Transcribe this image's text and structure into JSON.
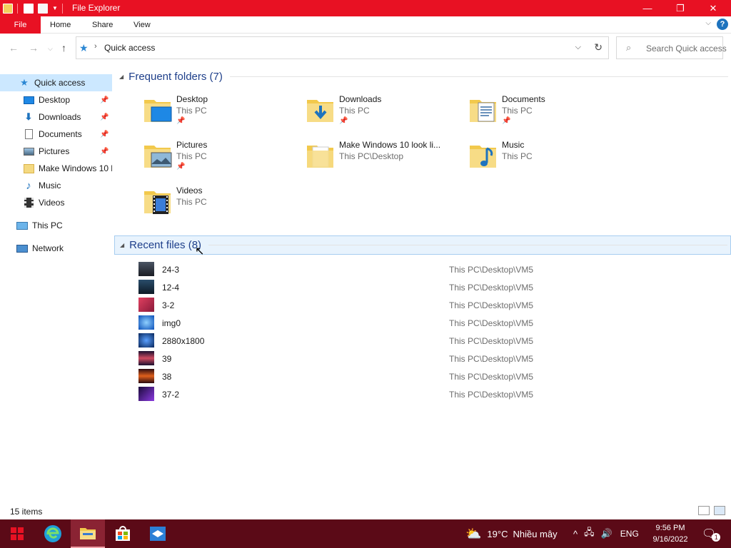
{
  "window": {
    "title": "File Explorer",
    "minimize_icon": "minimize-icon",
    "restore_icon": "restore-icon",
    "close_icon": "close-icon"
  },
  "ribbon": {
    "tabs": [
      "File",
      "Home",
      "Share",
      "View"
    ],
    "help": "?"
  },
  "address": {
    "location": "Quick access",
    "separator": "›"
  },
  "search": {
    "placeholder": "Search Quick access"
  },
  "nav": {
    "quick_access": "Quick access",
    "pinned": [
      {
        "label": "Desktop",
        "icon": "desktop-icon",
        "pinned": true
      },
      {
        "label": "Downloads",
        "icon": "download-icon",
        "pinned": true
      },
      {
        "label": "Documents",
        "icon": "document-icon",
        "pinned": true
      },
      {
        "label": "Pictures",
        "icon": "picture-icon",
        "pinned": true
      },
      {
        "label": "Make Windows 10 l",
        "icon": "folder-icon",
        "pinned": false
      },
      {
        "label": "Music",
        "icon": "music-icon",
        "pinned": false
      },
      {
        "label": "Videos",
        "icon": "video-icon",
        "pinned": false
      }
    ],
    "this_pc": "This PC",
    "network": "Network"
  },
  "frequent": {
    "title": "Frequent folders (7)",
    "items": [
      {
        "name": "Desktop",
        "location": "This PC",
        "pinned": true
      },
      {
        "name": "Downloads",
        "location": "This PC",
        "pinned": true
      },
      {
        "name": "Documents",
        "location": "This PC",
        "pinned": true
      },
      {
        "name": "Pictures",
        "location": "This PC",
        "pinned": true
      },
      {
        "name": "Make Windows 10 look li...",
        "location": "This PC\\Desktop",
        "pinned": false
      },
      {
        "name": "Music",
        "location": "This PC",
        "pinned": false
      },
      {
        "name": "Videos",
        "location": "This PC",
        "pinned": false
      }
    ]
  },
  "recent": {
    "title": "Recent files (8)",
    "files": [
      {
        "name": "24-3",
        "path": "This PC\\Desktop\\VM5",
        "color": "#2a2f38"
      },
      {
        "name": "12-4",
        "path": "This PC\\Desktop\\VM5",
        "color": "#1d3346"
      },
      {
        "name": "3-2",
        "path": "This PC\\Desktop\\VM5",
        "color": "#c8354a"
      },
      {
        "name": "img0",
        "path": "This PC\\Desktop\\VM5",
        "color": "#1a6fd0"
      },
      {
        "name": "2880x1800",
        "path": "This PC\\Desktop\\VM5",
        "color": "#0d3f8c"
      },
      {
        "name": "39",
        "path": "This PC\\Desktop\\VM5",
        "color": "#3a2350"
      },
      {
        "name": "38",
        "path": "This PC\\Desktop\\VM5",
        "color": "#c8481c"
      },
      {
        "name": "37-2",
        "path": "This PC\\Desktop\\VM5",
        "color": "#5b2a9a"
      }
    ]
  },
  "status": {
    "items": "15 items"
  },
  "taskbar": {
    "weather_temp": "19°C",
    "weather_text": "Nhiều mây",
    "lang": "ENG",
    "time": "9:56 PM",
    "date": "9/16/2022",
    "notifications": "1"
  },
  "colors": {
    "accent": "#e81123",
    "taskbar": "#5b0a17",
    "folder": "#f4cf5d",
    "link": "#1e3f8a"
  }
}
